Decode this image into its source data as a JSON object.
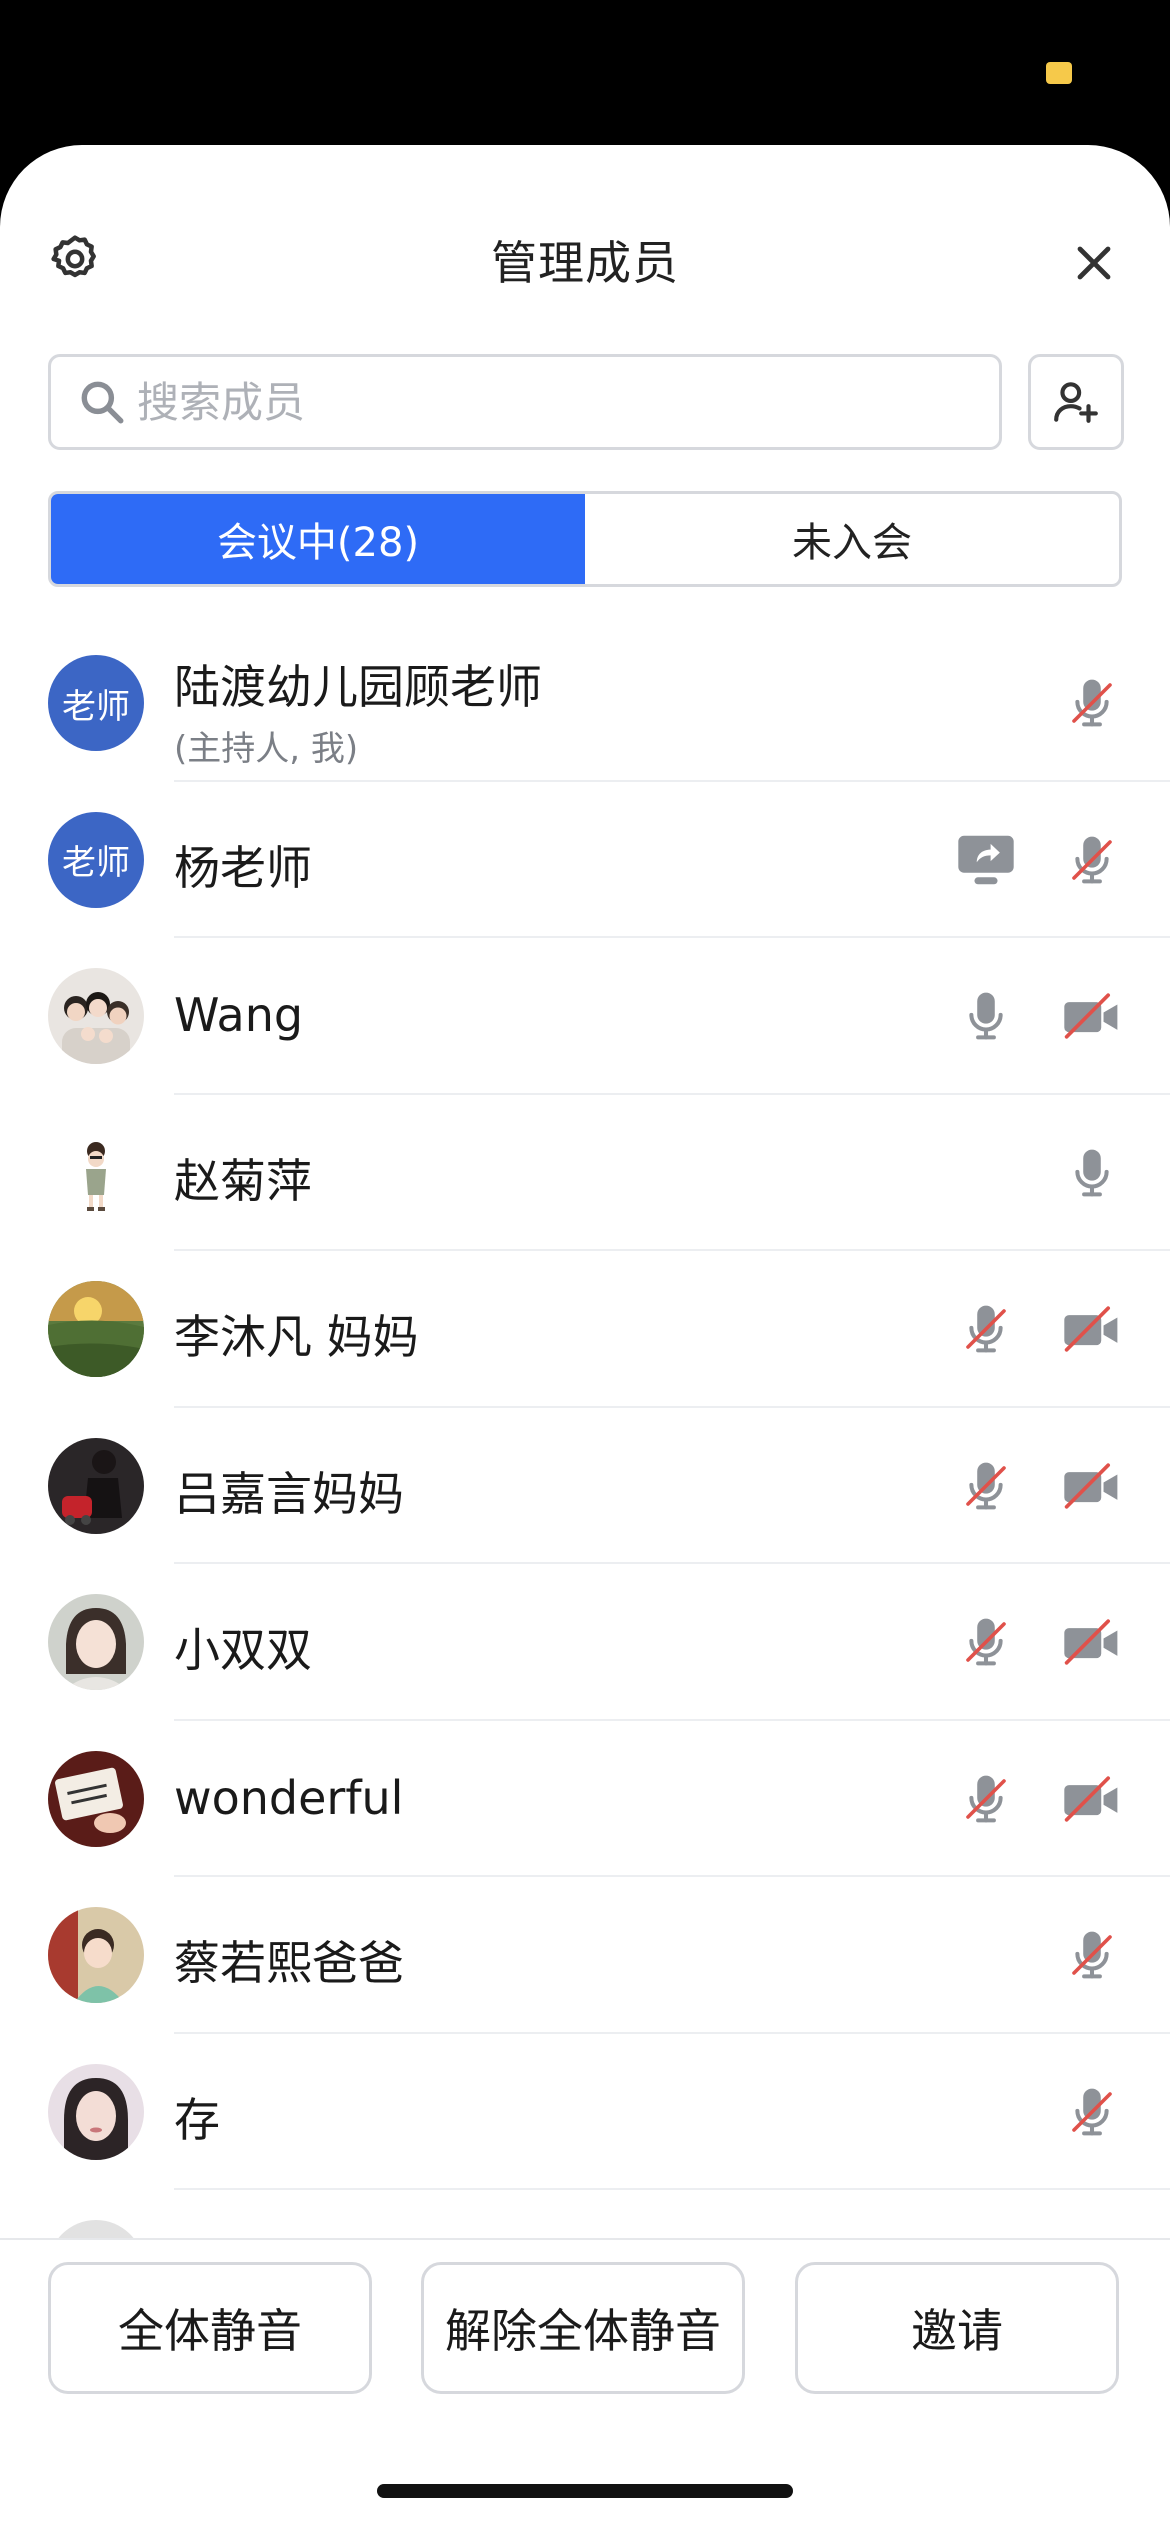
{
  "header": {
    "title": "管理成员"
  },
  "search": {
    "placeholder": "搜索成员"
  },
  "tabs": [
    {
      "label": "会议中(28)",
      "active": true
    },
    {
      "label": "未入会",
      "active": false
    }
  ],
  "members": [
    {
      "name": "陆渡幼儿园顾老师",
      "sub": "(主持人, 我)",
      "avatar_text": "老师"
    },
    {
      "name": "杨老师",
      "avatar_text": "老师"
    },
    {
      "name": "Wang"
    },
    {
      "name": "赵菊萍"
    },
    {
      "name": "李沐凡 妈妈"
    },
    {
      "name": "吕嘉言妈妈"
    },
    {
      "name": "小双双"
    },
    {
      "name": "wonderful"
    },
    {
      "name": "蔡若熙爸爸"
    },
    {
      "name": "存"
    }
  ],
  "bottom": {
    "mute_all": "全体静音",
    "unmute_all": "解除全体静音",
    "invite": "邀请"
  },
  "colors": {
    "accent": "#2e6bf6",
    "avatar_blue": "#3c66c5",
    "muted_slash": "#e0514a",
    "icon_gray": "#8e9298"
  }
}
